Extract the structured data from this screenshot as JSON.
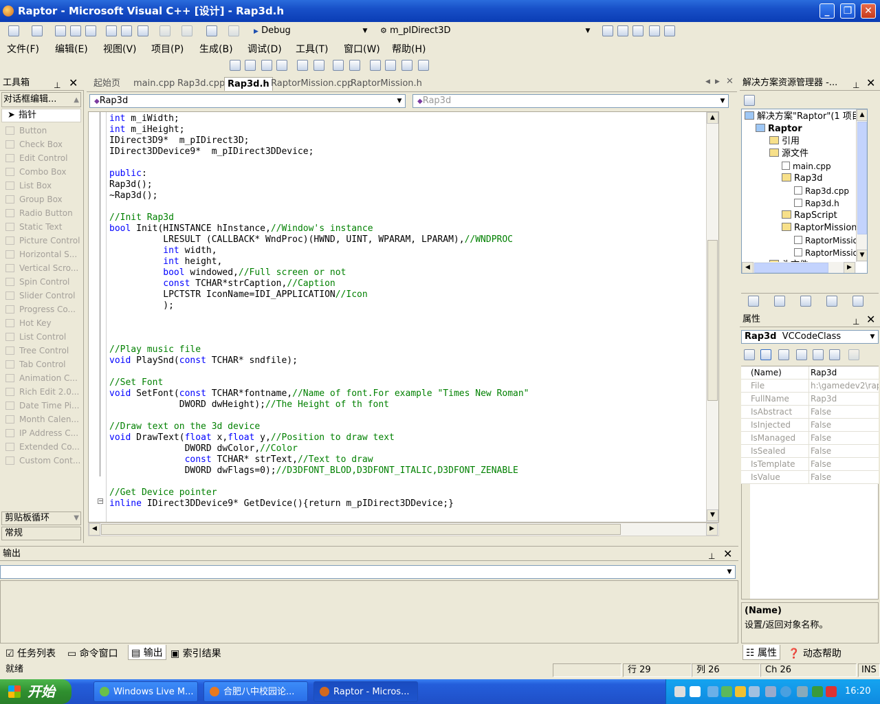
{
  "window": {
    "title": "Raptor - Microsoft Visual C++ [设计] - Rap3d.h"
  },
  "toolbar": {
    "config": "Debug",
    "function": "m_pIDirect3D"
  },
  "menu": [
    "文件(F)",
    "编辑(E)",
    "视图(V)",
    "项目(P)",
    "生成(B)",
    "调试(D)",
    "工具(T)",
    "窗口(W)",
    "帮助(H)"
  ],
  "toolbox": {
    "title": "工具箱",
    "section": "对话框编辑...",
    "pointer": "指针",
    "items": [
      "Button",
      "Check Box",
      "Edit Control",
      "Combo Box",
      "List Box",
      "Group Box",
      "Radio Button",
      "Static Text",
      "Picture Control",
      "Horizontal S...",
      "Vertical Scro...",
      "Spin Control",
      "Slider Control",
      "Progress Co...",
      "Hot Key",
      "List Control",
      "Tree Control",
      "Tab Control",
      "Animation C...",
      "Rich Edit 2.0...",
      "Date Time Pi...",
      "Month Calen...",
      "IP Address C...",
      "Extended Co...",
      "Custom Cont..."
    ],
    "clipboard": "剪贴板循环",
    "general": "常规"
  },
  "editor": {
    "tabs": [
      "起始页",
      "main.cpp",
      "Rap3d.cpp",
      "Rap3d.h",
      "RaptorMission.cpp",
      "RaptorMission.h"
    ],
    "active_tab": "Rap3d.h",
    "class_combo": "Rap3d",
    "member_combo": "Rap3d",
    "lines": [
      "int m_iWidth;",
      "int m_iHeight;",
      "IDirect3D9*  m_pIDirect3D;",
      "IDirect3DDevice9*  m_pIDirect3DDevice;",
      "",
      "public:",
      "Rap3d();",
      "~Rap3d();",
      "",
      "//Init Rap3d",
      "bool Init(HINSTANCE hInstance,//Window's instance",
      "          LRESULT (CALLBACK* WndProc)(HWND, UINT, WPARAM, LPARAM),//WNDPROC",
      "          int width,",
      "          int height,",
      "          bool windowed,//Full screen or not",
      "          const TCHAR*strCaption,//Caption",
      "          LPCTSTR IconName=IDI_APPLICATION//Icon",
      "          );",
      "",
      "",
      "",
      "//Play music file",
      "void PlaySnd(const TCHAR* sndfile);",
      "",
      "//Set Font",
      "void SetFont(const TCHAR*fontname,//Name of font.For example \"Times New Roman\"",
      "             DWORD dwHeight);//The Height of th font",
      "",
      "//Draw text on the 3d device",
      "void DrawText(float x,float y,//Position to draw text",
      "              DWORD dwColor,//Color",
      "              const TCHAR* strText,//Text to draw",
      "              DWORD dwFlags=0);//D3DFONT_BLOD,D3DFONT_ITALIC,D3DFONT_ZENABLE",
      "",
      "//Get Device pointer",
      "inline IDirect3DDevice9* GetDevice(){return m_pIDirect3DDevice;}"
    ]
  },
  "solution": {
    "title": "解决方案资源管理器 -...",
    "nodes": [
      {
        "label": "解决方案\"Raptor\"(1 项目",
        "kind": "sol"
      },
      {
        "label": "Raptor",
        "kind": "proj"
      },
      {
        "label": "引用",
        "kind": "folder"
      },
      {
        "label": "源文件",
        "kind": "folder"
      },
      {
        "label": "main.cpp",
        "kind": "file"
      },
      {
        "label": "Rap3d",
        "kind": "folder"
      },
      {
        "label": "Rap3d.cpp",
        "kind": "file"
      },
      {
        "label": "Rap3d.h",
        "kind": "file"
      },
      {
        "label": "RapScript",
        "kind": "folder"
      },
      {
        "label": "RaptorMission",
        "kind": "folder"
      },
      {
        "label": "RaptorMission",
        "kind": "file"
      },
      {
        "label": "RaptorMission",
        "kind": "file"
      },
      {
        "label": "头文件",
        "kind": "folder"
      }
    ]
  },
  "properties": {
    "title": "属性",
    "object": "Rap3d",
    "object_type": "VCCodeClass",
    "rows": [
      {
        "name": "(Name)",
        "value": "Rap3d"
      },
      {
        "name": "File",
        "value": "h:\\gamedev2\\rap"
      },
      {
        "name": "FullName",
        "value": "Rap3d"
      },
      {
        "name": "IsAbstract",
        "value": "False"
      },
      {
        "name": "IsInjected",
        "value": "False"
      },
      {
        "name": "IsManaged",
        "value": "False"
      },
      {
        "name": "IsSealed",
        "value": "False"
      },
      {
        "name": "IsTemplate",
        "value": "False"
      },
      {
        "name": "IsValue",
        "value": "False"
      }
    ],
    "desc_title": "(Name)",
    "desc_text": "设置/返回对象名称。"
  },
  "output": {
    "title": "输出"
  },
  "bottom_tabs": [
    "任务列表",
    "命令窗口",
    "输出",
    "索引结果"
  ],
  "right_tabs": [
    "属性",
    "动态帮助"
  ],
  "status": {
    "text": "就绪",
    "line": "行 29",
    "col": "列 26",
    "ch": "Ch 26",
    "mode": "INS"
  },
  "taskbar": {
    "start": "开始",
    "tasks": [
      "Windows Live M...",
      "合肥八中校园论...",
      "Raptor - Micros..."
    ],
    "clock": "16:20"
  }
}
